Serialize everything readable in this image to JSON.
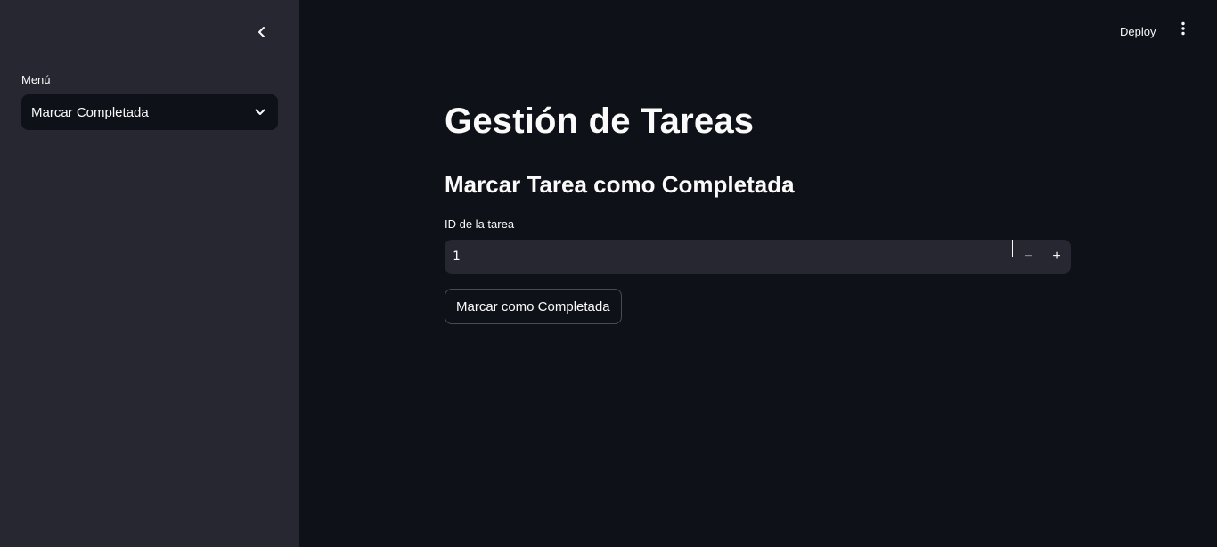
{
  "sidebar": {
    "menu_label": "Menú",
    "select_value": "Marcar Completada"
  },
  "header": {
    "deploy_label": "Deploy"
  },
  "main": {
    "title": "Gestión de Tareas",
    "subheader": "Marcar Tarea como Completada",
    "id_label": "ID de la tarea",
    "id_value": "1",
    "stepper_minus": "−",
    "stepper_plus": "+",
    "submit_label": "Marcar como Completada"
  },
  "theme": {
    "background": "#0e1117",
    "sidebar_background": "#262730",
    "input_background": "#262730",
    "text": "#fafafa"
  },
  "icons": {
    "collapse": "chevron-left-icon",
    "select": "chevron-down-icon",
    "menu": "kebab-menu-icon"
  }
}
